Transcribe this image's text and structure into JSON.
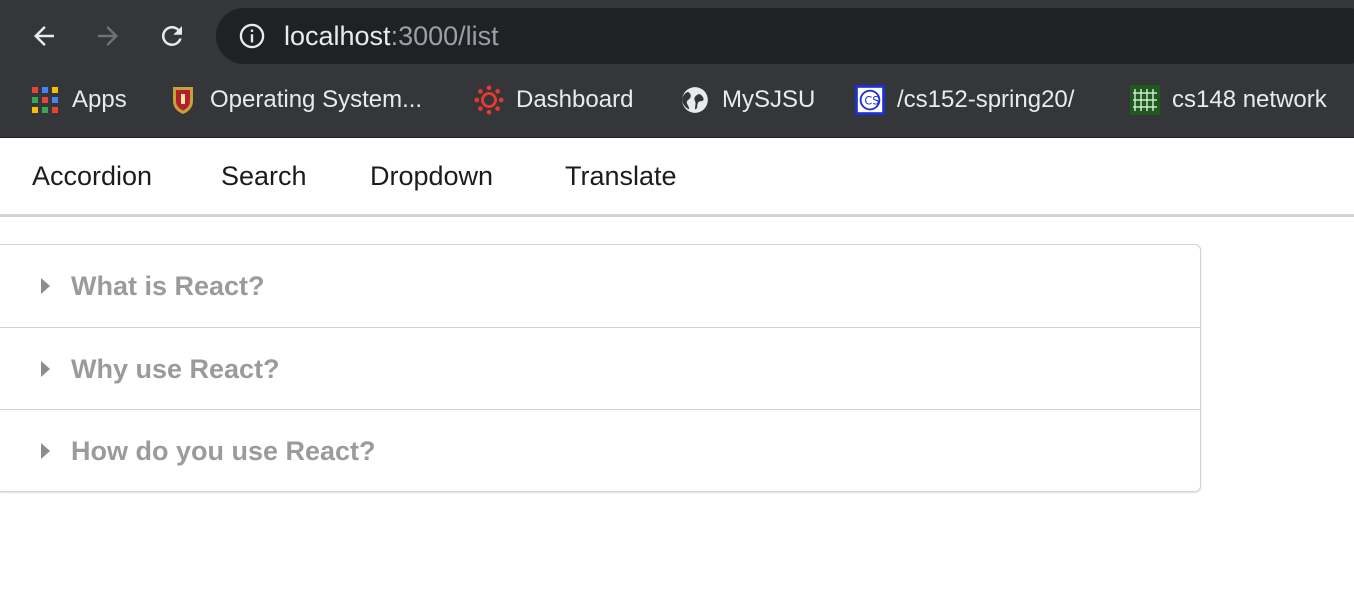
{
  "browser": {
    "url_host": "localhost",
    "url_rest": ":3000/list",
    "bookmarks": [
      {
        "label": "Apps",
        "icon": "apps-grid-icon"
      },
      {
        "label": "Operating System...",
        "icon": "university-crest-icon"
      },
      {
        "label": "Dashboard",
        "icon": "canvas-logo-icon"
      },
      {
        "label": "MySJSU",
        "icon": "globe-icon"
      },
      {
        "label": "/cs152-spring20/",
        "icon": "cs-logo-icon"
      },
      {
        "label": "cs148 network",
        "icon": "network-grid-icon"
      }
    ]
  },
  "menu": {
    "items": [
      "Accordion",
      "Search",
      "Dropdown",
      "Translate"
    ]
  },
  "accordion": {
    "items": [
      {
        "title": "What is React?"
      },
      {
        "title": "Why use React?"
      },
      {
        "title": "How do you use React?"
      }
    ]
  },
  "colors": {
    "toolbar_bg": "#35363a",
    "omnibox_bg": "#202124",
    "accordion_title": "#9b9b9b",
    "menu_text": "#1b1c1d"
  }
}
